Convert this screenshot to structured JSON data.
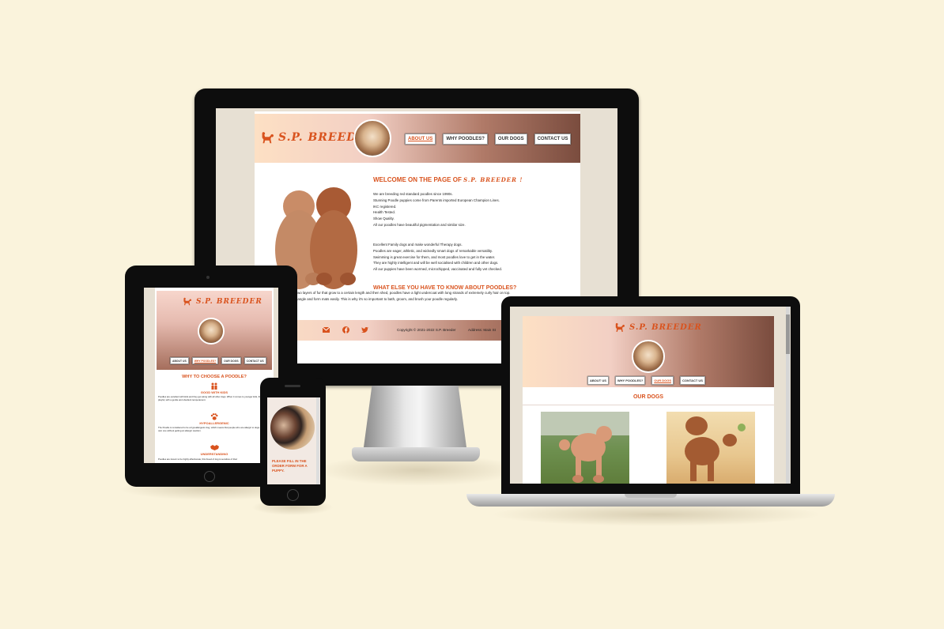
{
  "brand": {
    "name": "S.P. BREEDER",
    "accent": "#d9531e"
  },
  "nav": {
    "items": [
      "ABOUT US",
      "WHY POODLES?",
      "OUR DOGS",
      "CONTACT US"
    ]
  },
  "desktop": {
    "welcome_prefix": "WELCOME ON THE PAGE OF",
    "welcome_brand": "S.P. BREEDER !",
    "paragraph1": [
      "We are breeding red standard poodles since 1990s.",
      "Stunning Poodle puppies come from Parents imported European Champion Lines.",
      "IKC registered.",
      "Health Tested.",
      "Show Quality.",
      "All our poodles have beautiful pigmentation and similar size."
    ],
    "paragraph2": [
      "Excellent Family dogs and make wonderful Therapy dogs.",
      "Poodles are eager, athletic, and wickedly smart dogs of remarkable versatility.",
      "Swimming is great exercise for them, and most poodles love to get in the water.",
      "They are highly intelligent and will be well socialised with children and other dogs.",
      "All our puppies have been wormed, microchipped, vaccinated and fully vet checked."
    ],
    "heading2": "WHAT ELSE YOU HAVE TO KNOW ABOUT POODLES?",
    "paragraph3": [
      "ve two layers of fur that grow to a certain length and then shed, poodles have a light undercoat with long strands of extremely curly hair on top.",
      "an tangle and form mats easily. This is why it's so important to bath, groom, and brush your poodle regularly."
    ],
    "footer": {
      "copyright": "Copyright © 2021-2022 S.P. Breeder",
      "address": "Address: Main St"
    },
    "social_icons": [
      "envelope-icon",
      "facebook-icon",
      "twitter-icon"
    ]
  },
  "tablet": {
    "heading": "WHY TO CHOOSE A POODLE?",
    "features": [
      {
        "title": "GOOD WITH KIDS",
        "icon": "family-icon",
        "text": "Poodles are excellent with kids and they get along with all other dogs. When it comes to younger kids, they are playful, with a gentle and obedient temperament."
      },
      {
        "title": "HYPOALLERGENIC",
        "icon": "paw-icon",
        "text": "The Poodle is considered to be a hypoallergenic dog, which means that people who are allergic to dogs can still own one without getting an allergic reaction."
      },
      {
        "title": "UNDERSTANDING",
        "icon": "handshake-icon",
        "text": "Poodles are known to be highly affectionate; this breed of dog is sensitive of their"
      }
    ]
  },
  "phone": {
    "cta": "PLEASE FILL IN THE ORDER FORM FOR A PUPPY."
  },
  "laptop": {
    "section_title": "OUR DOGS"
  }
}
